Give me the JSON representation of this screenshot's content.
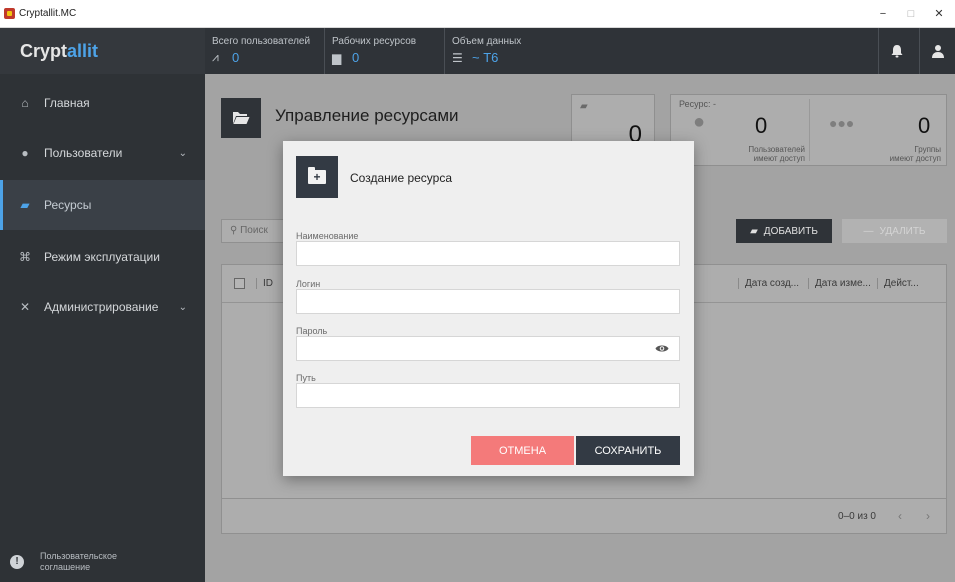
{
  "window": {
    "title": "Cryptallit.MC",
    "minimize": "−",
    "maximize": "□",
    "close": "✕"
  },
  "header": {
    "logo": {
      "part1": "Crypt",
      "part2": "allit"
    },
    "stats": [
      {
        "label": "Всего пользователей",
        "value": "0",
        "icon": "trend-icon"
      },
      {
        "label": "Рабочих ресурсов",
        "value": "0",
        "icon": "folder-icon"
      },
      {
        "label": "Объем данных",
        "value": "~ Т6",
        "icon": "database-icon"
      }
    ]
  },
  "sidebar": {
    "items": [
      {
        "label": "Главная",
        "icon": "home-icon"
      },
      {
        "label": "Пользователи",
        "icon": "user-icon"
      },
      {
        "label": "Ресурсы",
        "icon": "folder-icon"
      },
      {
        "label": "Режим эксплуатации",
        "icon": "mode-icon"
      },
      {
        "label": "Администрирование",
        "icon": "tools-icon"
      }
    ],
    "footer": {
      "line1": "Пользовательское",
      "line2": "соглашение"
    }
  },
  "main": {
    "title": "Управление ресурсами",
    "resources_count": "0",
    "access": {
      "resource_label": "Ресурс: -",
      "users_value": "0",
      "users_label_1": "Пользователей",
      "users_label_2": "имеют доступ",
      "groups_value": "0",
      "groups_label_1": "Группы",
      "groups_label_2": "имеют доступ"
    },
    "search_placeholder": "Поиск",
    "add_label": "ДОБАВИТЬ",
    "delete_label": "УДАЛИТЬ",
    "table_headers": [
      "ID",
      "Дата созд...",
      "Дата изме...",
      "Дейст..."
    ],
    "pagination": "0–0 из 0"
  },
  "dialog": {
    "title": "Создание ресурса",
    "fields": [
      {
        "label": "Наименование",
        "value": ""
      },
      {
        "label": "Логин",
        "value": ""
      },
      {
        "label": "Пароль",
        "value": ""
      },
      {
        "label": "Путь",
        "value": ""
      }
    ],
    "cancel_label": "ОТМЕНА",
    "save_label": "СОХРАНИТЬ"
  },
  "colors": {
    "accent": "#4da3e8",
    "dark": "#2f3338",
    "cancel": "#f47a7a",
    "save": "#333a44"
  }
}
